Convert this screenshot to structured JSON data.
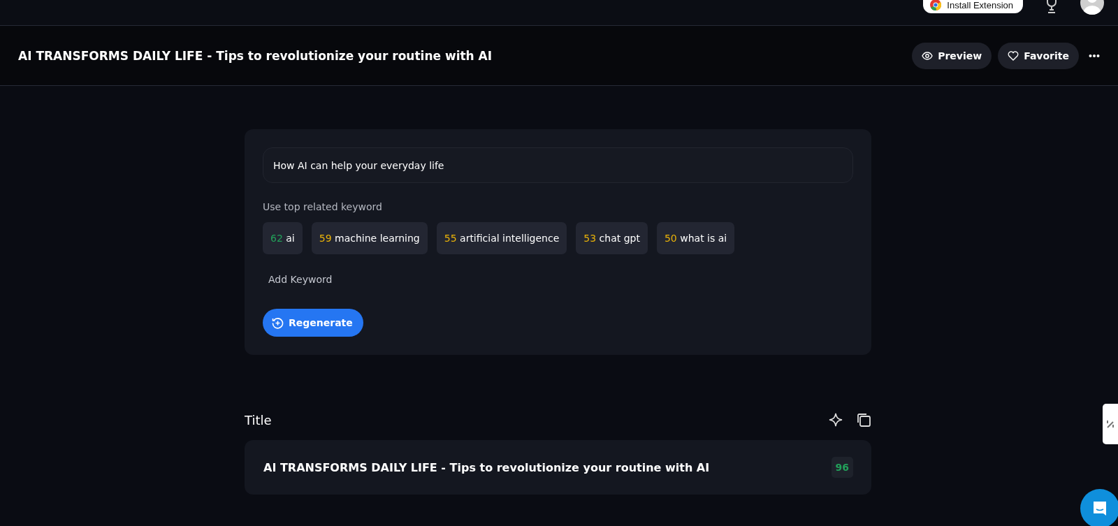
{
  "top_bar": {
    "install_button": "Install Extension"
  },
  "header": {
    "title": "AI TRANSFORMS DAILY LIFE - Tips to revolutionize your routine with AI",
    "buttons": [
      {
        "kind": "preview",
        "label": "Preview"
      },
      {
        "kind": "favorite",
        "label": "Favorite"
      }
    ]
  },
  "topic_field": {
    "value": "How AI can help your everyday life"
  },
  "keywords_label": "Use top related keyword",
  "keywords": [
    {
      "score": "62",
      "label": "ai",
      "color": "#22a05a"
    },
    {
      "score": "59",
      "label": "machine learning",
      "color": "#eab308"
    },
    {
      "score": "55",
      "label": "artificial intelligence",
      "color": "#eab308"
    },
    {
      "score": "53",
      "label": "chat gpt",
      "color": "#eab308"
    },
    {
      "score": "50",
      "label": "what is ai",
      "color": "#eab308"
    }
  ],
  "add_keyword": "Add Keyword",
  "regenerate_button": "Regenerate",
  "title_section": {
    "heading": "Title",
    "text": "AI TRANSFORMS DAILY LIFE - Tips to revolutionize your routine with AI",
    "score": "96",
    "color": "#22a05a"
  }
}
